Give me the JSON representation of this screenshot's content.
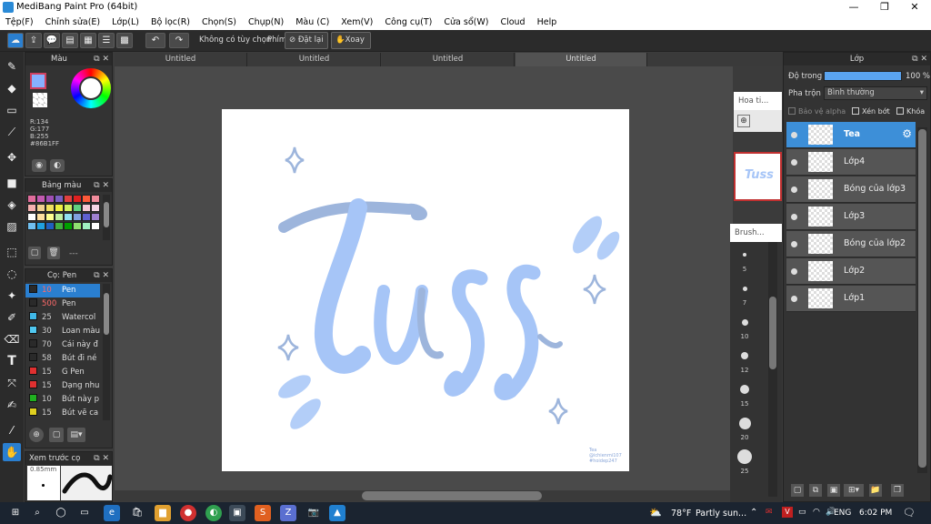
{
  "title": "MediBang Paint Pro (64bit)",
  "window": {
    "minimize": "—",
    "maximize": "❐",
    "close": "✕"
  },
  "menu": [
    "Tệp(F)",
    "Chỉnh sửa(E)",
    "Lớp(L)",
    "Bộ lọc(R)",
    "Chọn(S)",
    "Chụp(N)",
    "Màu (C)",
    "Xem(V)",
    "Công cụ(T)",
    "Cửa sổ(W)",
    "Cloud",
    "Help"
  ],
  "toolbar": {
    "no_option": "Không có tùy chọn",
    "keys": "Phím",
    "reset": "Đặt lại",
    "rotate": "Xoay"
  },
  "tabs": [
    "Untitled",
    "Untitled",
    "Untitled",
    "Untitled"
  ],
  "color_panel": {
    "title": "Màu",
    "r": "R:134",
    "g": "G:177",
    "b": "B:255",
    "hex": "#86B1FF",
    "main_color": "#86b1ff"
  },
  "palette_panel": {
    "title": "Bảng màu",
    "more": "---",
    "colors": [
      "#e06c9c",
      "#c25ab0",
      "#a04fb5",
      "#7b5fc0",
      "#e04040",
      "#e02020",
      "#ff5a3a",
      "#f08c9c",
      "#f5b0b0",
      "#f0d090",
      "#f0e060",
      "#f0f040",
      "#d0f060",
      "#60d080",
      "#f6c9d6",
      "#f5d5e5",
      "#fff",
      "#ffe0a0",
      "#ffff90",
      "#c0f0a0",
      "#90e0f0",
      "#80a0e0",
      "#6060d0",
      "#a080d0",
      "#70c0f0",
      "#20a0e0",
      "#2060c0",
      "#40b040",
      "#00a000",
      "#90e070",
      "#a0f0c0",
      "#ffffff"
    ]
  },
  "brush_panel": {
    "title": "Cọ: Pen",
    "items": [
      {
        "size": "10",
        "name": "Pen",
        "color": "#2a2a2a"
      },
      {
        "size": "500",
        "name": "Pen",
        "color": "#2a2a2a"
      },
      {
        "size": "25",
        "name": "Watercol",
        "color": "#40b8e8"
      },
      {
        "size": "30",
        "name": "Loan màu",
        "color": "#50c8f0"
      },
      {
        "size": "70",
        "name": "Cái này đ",
        "color": "#2a2a2a"
      },
      {
        "size": "58",
        "name": "Bút đi né",
        "color": "#2a2a2a"
      },
      {
        "size": "15",
        "name": "G Pen",
        "color": "#e03030"
      },
      {
        "size": "15",
        "name": "Dạng nhu",
        "color": "#e03030"
      },
      {
        "size": "10",
        "name": "Bút này p",
        "color": "#20b020"
      },
      {
        "size": "15",
        "name": "Bút vẽ ca",
        "color": "#e0d020"
      }
    ]
  },
  "preview_panel": {
    "title": "Xem trước cọ",
    "size": "0.85mm"
  },
  "navigator": {
    "title": "Hoa ti..."
  },
  "brush_size_panel": {
    "title": "Brush...",
    "sizes": [
      "5",
      "7",
      "10",
      "12",
      "15",
      "20",
      "25"
    ]
  },
  "layer_panel": {
    "title": "Lớp",
    "opacity_label": "Độ trong",
    "opacity_value": "100 %",
    "blend_label": "Pha trộn",
    "blend_value": "Bình thường",
    "protect_alpha": "Bảo vệ alpha",
    "clip": "Xén bớt",
    "lock": "Khóa",
    "layers": [
      "Tea",
      "Lớp4",
      "Bóng của lớp3",
      "Lớp3",
      "Bóng của lớp2",
      "Lớp2",
      "Lớp1"
    ]
  },
  "artwork": {
    "text": "Tuss",
    "signature": [
      "Tea",
      "@ichienmi107",
      "#hoidep247"
    ]
  },
  "taskbar": {
    "weather_temp": "78°F",
    "weather_desc": "Partly sun...",
    "lang": "ENG",
    "time": "6:02 PM"
  }
}
